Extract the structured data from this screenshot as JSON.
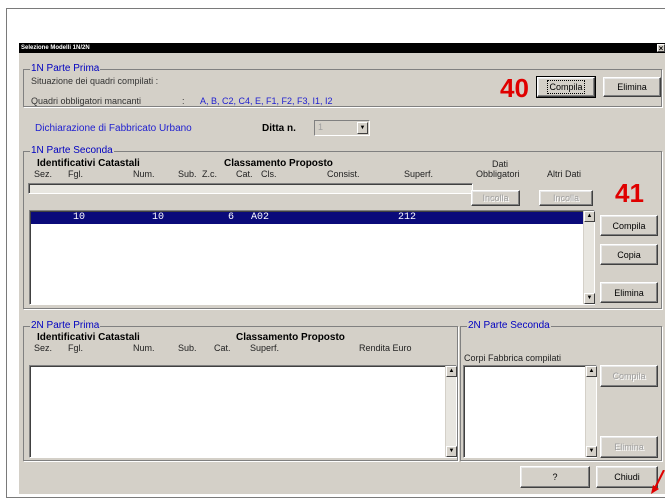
{
  "window": {
    "title": "Selezione Modelli 1N/2N",
    "close_glyph": "×"
  },
  "annotations": {
    "a40": "40",
    "a41": "41"
  },
  "parte_prima_1n": {
    "legend": "1N Parte Prima",
    "situazione_label": "Situazione dei quadri compilati :",
    "mancanti_label": "Quadri obbligatori mancanti",
    "mancanti_sep": ":",
    "mancanti_value": "A, B, C2, C4, E, F1, F2, F3, I1, I2",
    "btn_compila": "Compila",
    "btn_elimina": "Elimina"
  },
  "dichiarazione": {
    "label": "Dichiarazione di Fabbricato Urbano",
    "ditta_label": "Ditta n.",
    "ditta_value": "1"
  },
  "parte_seconda_1n": {
    "legend": "1N Parte Seconda",
    "hdr_identificativi": "Identificativi Catastali",
    "hdr_classamento": "Classamento Proposto",
    "hdr_dati": "Dati",
    "columns": {
      "sez": "Sez.",
      "fgl": "Fgl.",
      "num": "Num.",
      "sub": "Sub.",
      "zc": "Z.c.",
      "cat": "Cat.",
      "cls": "Cls.",
      "consist": "Consist.",
      "superf": "Superf.",
      "obbligatori": "Obbligatori",
      "altri": "Altri Dati"
    },
    "btn_incolla1": "Incolla",
    "btn_incolla2": "Incolla",
    "row": {
      "fgl": "10",
      "num": "10",
      "zc": "6",
      "cat": "A02",
      "superf": "212"
    },
    "btn_compila": "Compila",
    "btn_copia": "Copia",
    "btn_elimina": "Elimina"
  },
  "parte_prima_2n": {
    "legend": "2N Parte Prima",
    "hdr_identificativi": "Identificativi Catastali",
    "hdr_classamento": "Classamento Proposto",
    "columns": {
      "sez": "Sez.",
      "fgl": "Fgl.",
      "num": "Num.",
      "sub": "Sub.",
      "cat": "Cat.",
      "superf": "Superf.",
      "rendita": "Rendita Euro"
    }
  },
  "parte_seconda_2n": {
    "legend": "2N Parte Seconda",
    "corpi_label": "Corpi Fabbrica compilati",
    "btn_compila": "Compila",
    "btn_elimina": "Elimina"
  },
  "footer": {
    "btn_help": "?",
    "btn_chiudi": "Chiudi"
  },
  "colors": {
    "accent_blue": "#2020d0",
    "selection": "#0a0a7a",
    "annotation_red": "#e00000",
    "face": "#d4d0c8"
  },
  "icons": [
    "close-icon",
    "dropdown-arrow-icon",
    "scroll-up-icon",
    "scroll-down-icon",
    "pointer-arrow-icon"
  ]
}
